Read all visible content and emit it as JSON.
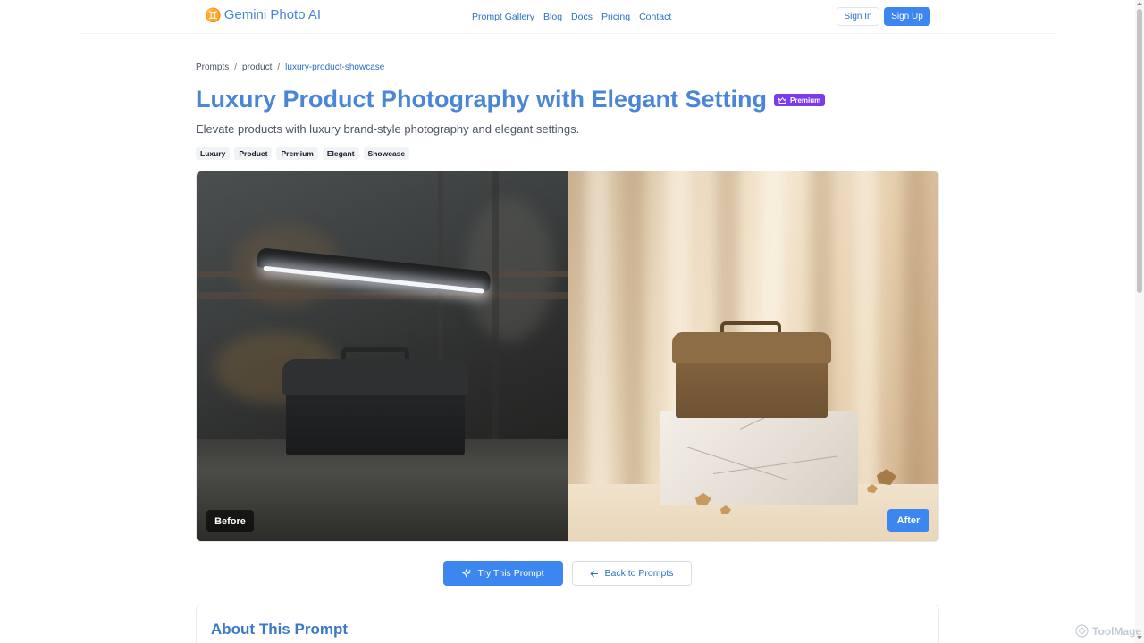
{
  "header": {
    "logo_mark": "♊",
    "logo_text": "Gemini Photo AI",
    "nav": [
      "Prompt Gallery",
      "Blog",
      "Docs",
      "Pricing",
      "Contact"
    ],
    "sign_in": "Sign In",
    "sign_up": "Sign Up"
  },
  "breadcrumb": {
    "items": [
      "Prompts",
      "product",
      "luxury-product-showcase"
    ],
    "separator": "/"
  },
  "page": {
    "title": "Luxury Product Photography with Elegant Setting",
    "badge": "Premium",
    "subtitle": "Elevate products with luxury brand-style photography and elegant settings.",
    "tags": [
      "Luxury",
      "Product",
      "Premium",
      "Elegant",
      "Showcase"
    ]
  },
  "compare": {
    "before_label": "Before",
    "after_label": "After"
  },
  "actions": {
    "try_label": "Try This Prompt",
    "back_label": "Back to Prompts"
  },
  "about": {
    "title": "About This Prompt"
  },
  "watermark": {
    "text": "ToolMage"
  },
  "colors": {
    "accent": "#3b86ef",
    "title": "#4a86d8",
    "badge": "#7c3aed"
  },
  "icons": {
    "try": "sparkles-icon",
    "back": "arrow-left-icon",
    "badge": "crown-icon"
  }
}
